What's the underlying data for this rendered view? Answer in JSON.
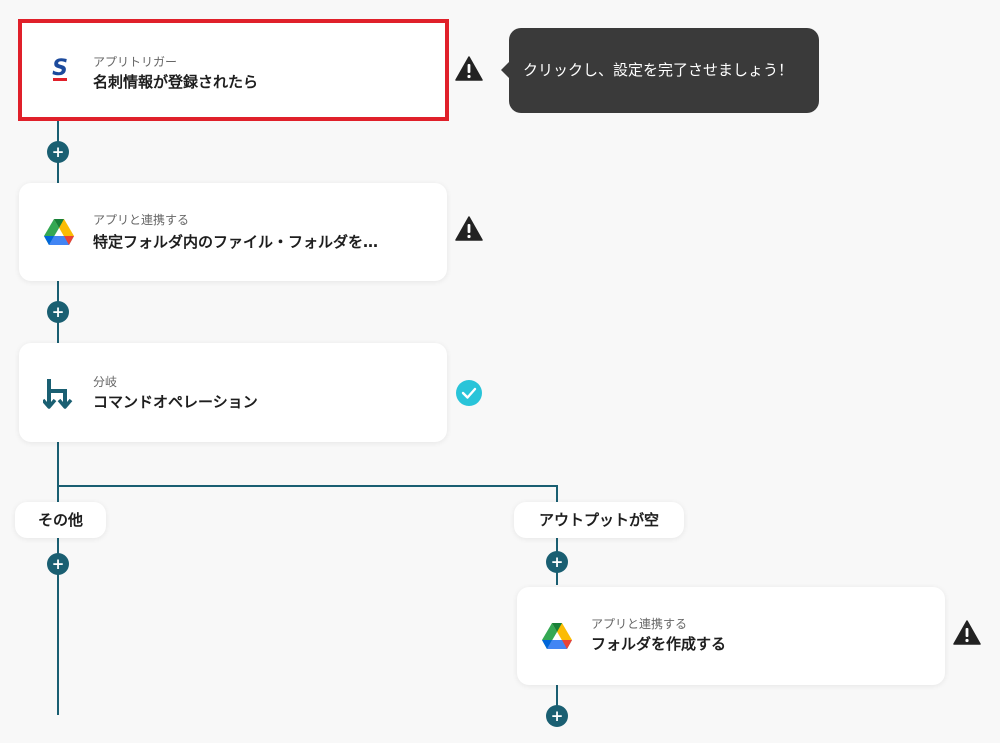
{
  "steps": [
    {
      "sub": "アプリトリガー",
      "title": "名刺情報が登録されたら",
      "icon": "sansan-icon"
    },
    {
      "sub": "アプリと連携する",
      "title": "特定フォルダ内のファイル・フォルダを…",
      "icon": "google-drive-icon"
    },
    {
      "sub": "分岐",
      "title": "コマンドオペレーション",
      "icon": "branch-icon"
    },
    {
      "sub": "アプリと連携する",
      "title": "フォルダを作成する",
      "icon": "google-drive-icon"
    }
  ],
  "tooltip": {
    "text": "クリックし、設定を完了させましょう！"
  },
  "branches": {
    "other": "その他",
    "empty": "アウトプットが空"
  },
  "colors": {
    "line": "#1a5f72",
    "selected_border": "#e0202a",
    "check": "#29c4d9",
    "warning": "#222222"
  }
}
